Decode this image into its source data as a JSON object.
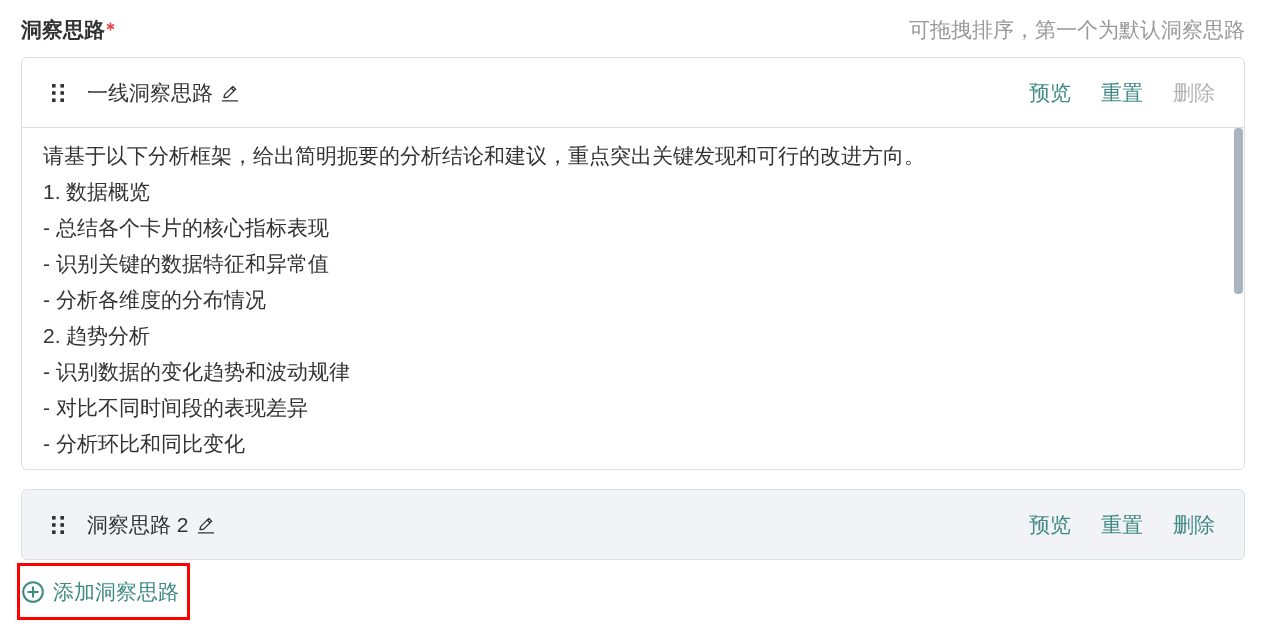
{
  "section": {
    "title": "洞察思路",
    "required": true,
    "hint": "可拖拽排序，第一个为默认洞察思路"
  },
  "insights": [
    {
      "title": "一线洞察思路",
      "expanded": true,
      "actions": [
        {
          "label": "预览",
          "disabled": false
        },
        {
          "label": "重置",
          "disabled": false
        },
        {
          "label": "删除",
          "disabled": true
        }
      ],
      "prompt": "请基于以下分析框架，给出简明扼要的分析结论和建议，重点突出关键发现和可行的改进方向。\n1. 数据概览\n- 总结各个卡片的核心指标表现\n- 识别关键的数据特征和异常值\n- 分析各维度的分布情况\n2. 趋势分析\n- 识别数据的变化趋势和波动规律\n- 对比不同时间段的表现差异\n- 分析环比和同比变化"
    },
    {
      "title": "洞察思路 2",
      "expanded": false,
      "actions": [
        {
          "label": "预览",
          "disabled": false
        },
        {
          "label": "重置",
          "disabled": false
        },
        {
          "label": "删除",
          "disabled": false
        }
      ]
    }
  ],
  "add_button": {
    "label": "添加洞察思路",
    "highlighted": true
  }
}
